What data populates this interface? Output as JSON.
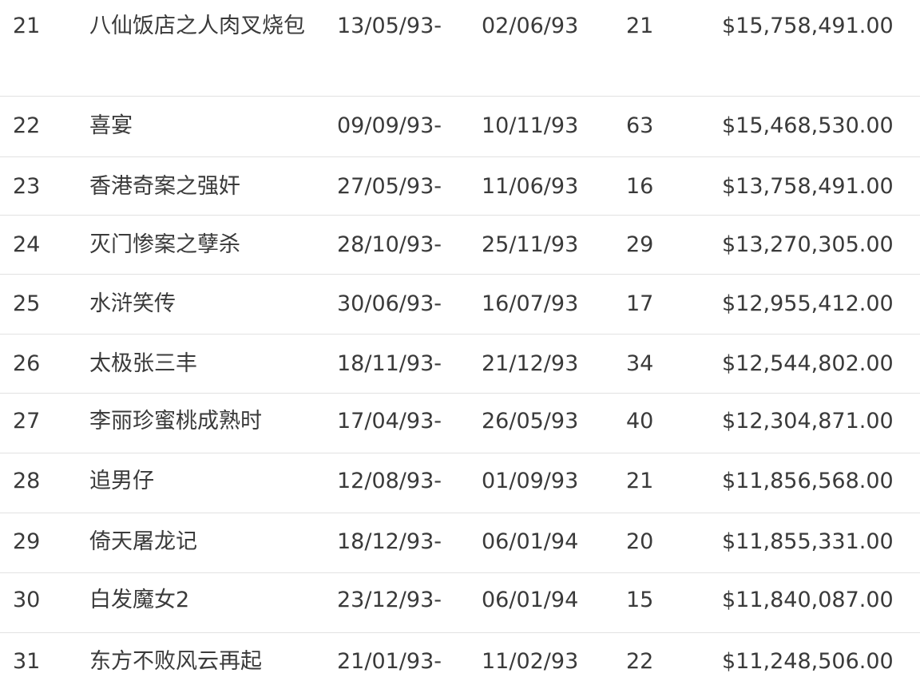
{
  "table": {
    "rows": [
      {
        "rank": "21",
        "title": "八仙饭店之人肉叉烧包",
        "start": "13/05/93-",
        "end": "02/06/93",
        "days": "21",
        "gross": "$15,758,491.00"
      },
      {
        "rank": "22",
        "title": "喜宴",
        "start": "09/09/93-",
        "end": "10/11/93",
        "days": "63",
        "gross": "$15,468,530.00"
      },
      {
        "rank": "23",
        "title": "香港奇案之强奸",
        "start": "27/05/93-",
        "end": "11/06/93",
        "days": "16",
        "gross": "$13,758,491.00"
      },
      {
        "rank": "24",
        "title": "灭门惨案之孽杀",
        "start": "28/10/93-",
        "end": "25/11/93",
        "days": "29",
        "gross": "$13,270,305.00"
      },
      {
        "rank": "25",
        "title": "水浒笑传",
        "start": "30/06/93-",
        "end": "16/07/93",
        "days": "17",
        "gross": "$12,955,412.00"
      },
      {
        "rank": "26",
        "title": "太极张三丰",
        "start": "18/11/93-",
        "end": "21/12/93",
        "days": "34",
        "gross": "$12,544,802.00"
      },
      {
        "rank": "27",
        "title": "李丽珍蜜桃成熟时",
        "start": "17/04/93-",
        "end": "26/05/93",
        "days": "40",
        "gross": "$12,304,871.00"
      },
      {
        "rank": "28",
        "title": "追男仔",
        "start": "12/08/93-",
        "end": "01/09/93",
        "days": "21",
        "gross": "$11,856,568.00"
      },
      {
        "rank": "29",
        "title": "倚天屠龙记",
        "start": "18/12/93-",
        "end": "06/01/94",
        "days": "20",
        "gross": "$11,855,331.00"
      },
      {
        "rank": "30",
        "title": "白发魔女2",
        "start": "23/12/93-",
        "end": "06/01/94",
        "days": "15",
        "gross": "$11,840,087.00"
      },
      {
        "rank": "31",
        "title": "东方不败风云再起",
        "start": "21/01/93-",
        "end": "11/02/93",
        "days": "22",
        "gross": "$11,248,506.00"
      }
    ]
  }
}
